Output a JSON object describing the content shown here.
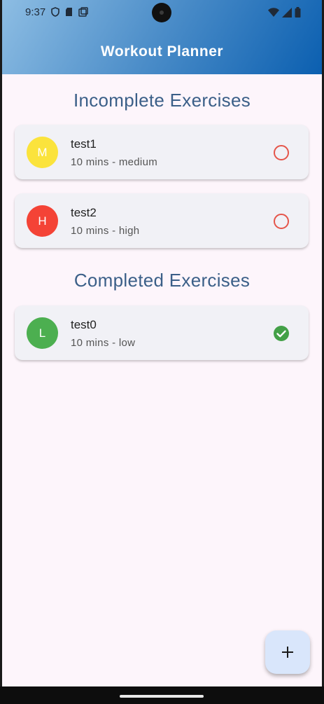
{
  "status_bar": {
    "time": "9:37"
  },
  "app_bar": {
    "title": "Workout Planner"
  },
  "sections": {
    "incomplete_title": "Incomplete Exercises",
    "completed_title": "Completed Exercises"
  },
  "incomplete_exercises": [
    {
      "avatar": "M",
      "avatar_color": "#fbe33c",
      "name": "test1",
      "detail": "10 mins - medium",
      "status": "incomplete"
    },
    {
      "avatar": "H",
      "avatar_color": "#f44336",
      "name": "test2",
      "detail": "10 mins - high",
      "status": "incomplete"
    }
  ],
  "completed_exercises": [
    {
      "avatar": "L",
      "avatar_color": "#4caf50",
      "name": "test0",
      "detail": "10 mins - low",
      "status": "completed"
    }
  ],
  "colors": {
    "incomplete_ring": "#e5554a",
    "completed_check": "#43a047",
    "section_title": "#3b5f88"
  },
  "fab": {
    "icon": "plus-icon"
  }
}
